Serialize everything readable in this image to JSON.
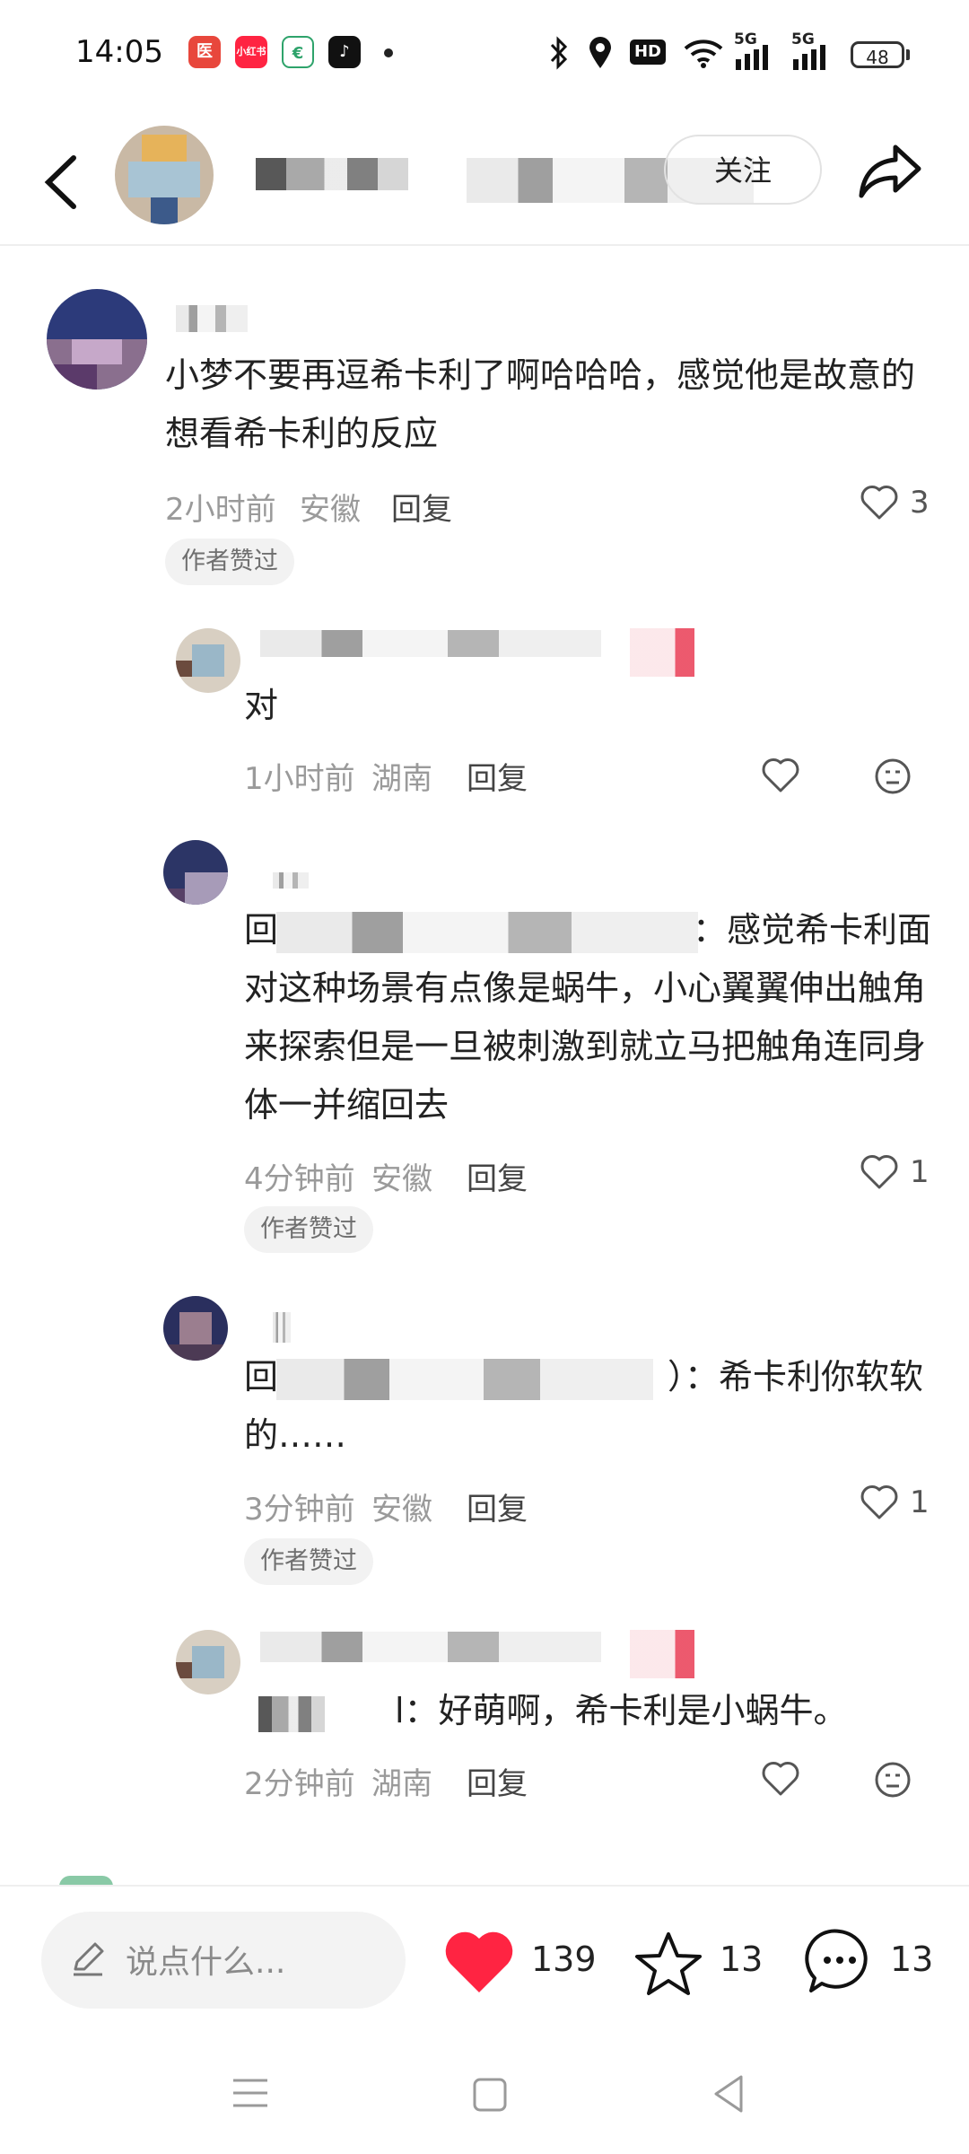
{
  "status_bar": {
    "time": "14:05",
    "apps": [
      {
        "name": "医",
        "color": "#e8473c"
      },
      {
        "name": "小红书",
        "color": "#ff2442"
      },
      {
        "name": "€",
        "color": "#2ea36b"
      },
      {
        "name": "♪",
        "color": "#111111"
      }
    ],
    "network_5g_1": "5G",
    "network_5g_2": "5G",
    "hd_label": "HD",
    "battery": "48"
  },
  "header": {
    "follow_label": "关注"
  },
  "comments": {
    "c1": {
      "text": "小梦不要再逗希卡利了啊哈哈哈，感觉他是故意的想看希卡利的反应",
      "time": "2小时前",
      "location": "安徽",
      "reply": "回复",
      "likes": "3",
      "badge": "作者赞过"
    },
    "r1": {
      "text": "对",
      "time": "1小时前",
      "location": "湖南",
      "reply": "回复"
    },
    "r2": {
      "prefix": "回",
      "text": "：感觉希卡利面对这种场景有点像是蜗牛，小心翼翼伸出触角来探索但是一旦被刺激到就立马把触角连同身体一并缩回去",
      "time": "4分钟前",
      "location": "安徽",
      "reply": "回复",
      "likes": "1",
      "badge": "作者赞过"
    },
    "r3": {
      "prefix": "回",
      "text": "）：希卡利你软软的……",
      "time": "3分钟前",
      "location": "安徽",
      "reply": "回复",
      "likes": "1",
      "badge": "作者赞过"
    },
    "r4": {
      "text": "l：好萌啊，希卡利是小蜗牛。",
      "time": "2分钟前",
      "location": "湖南",
      "reply": "回复"
    }
  },
  "bottom_bar": {
    "input_placeholder": "说点什么...",
    "like_count": "139",
    "star_count": "13",
    "comment_count": "13",
    "heart_color": "#ff2442"
  }
}
